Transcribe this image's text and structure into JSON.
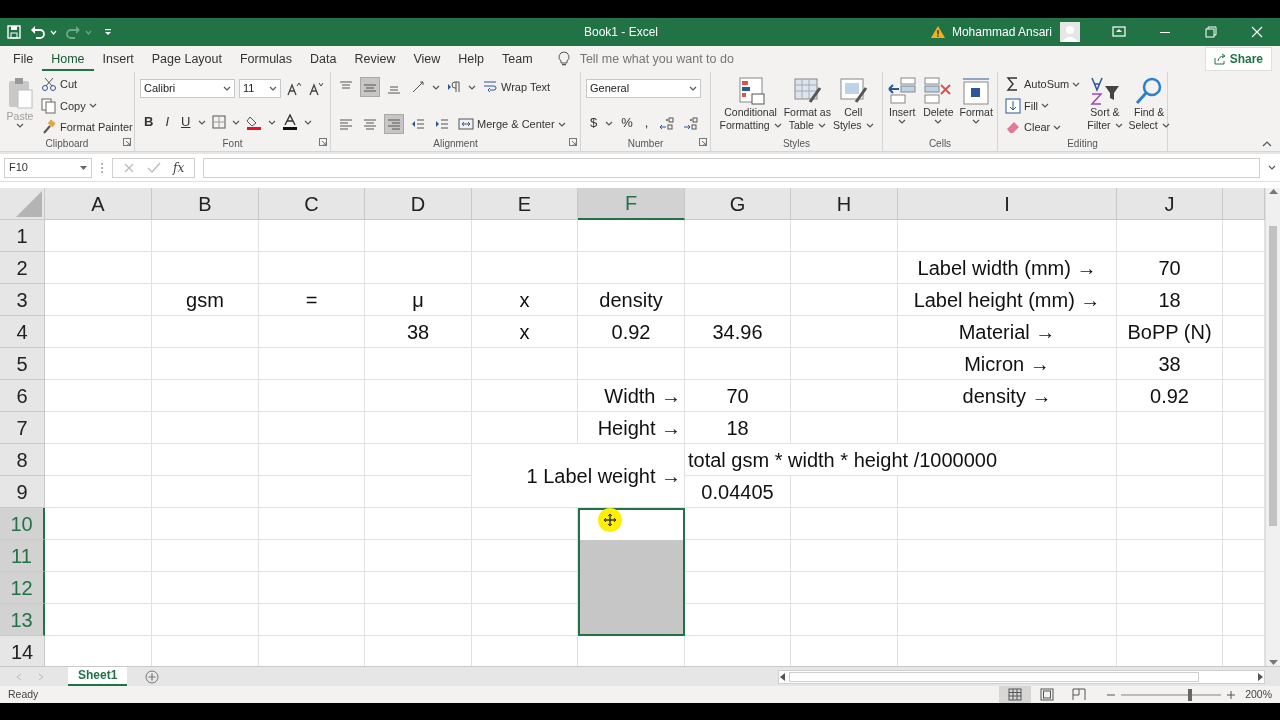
{
  "quick_access": [
    {
      "kind": "save",
      "disabled": false
    },
    {
      "kind": "undo",
      "disabled": false
    },
    {
      "kind": "redo",
      "disabled": true
    },
    {
      "kind": "customize",
      "disabled": false
    }
  ],
  "window": {
    "title": "Book1  -  Excel",
    "user": "Mohammad Ansari"
  },
  "menu_tabs": [
    {
      "label": "File",
      "selected": false
    },
    {
      "label": "Home",
      "selected": true
    },
    {
      "label": "Insert",
      "selected": false
    },
    {
      "label": "Page Layout",
      "selected": false
    },
    {
      "label": "Formulas",
      "selected": false
    },
    {
      "label": "Data",
      "selected": false
    },
    {
      "label": "Review",
      "selected": false
    },
    {
      "label": "View",
      "selected": false
    },
    {
      "label": "Help",
      "selected": false
    },
    {
      "label": "Team",
      "selected": false
    }
  ],
  "tell_me": {
    "placeholder": "Tell me what you want to do"
  },
  "share": "Share",
  "clipboard": {
    "group": "Clipboard",
    "paste": {
      "label": "Paste",
      "disabled": true
    },
    "cut": "Cut",
    "copy": "Copy",
    "format_painter": "Format Painter"
  },
  "font": {
    "group": "Font",
    "font_name": "Calibri",
    "font_size": "11",
    "format_buttons": [
      "B",
      "I",
      "U"
    ]
  },
  "alignment": {
    "group": "Alignment",
    "vertical_align": [
      {
        "selected": false
      },
      {
        "selected": true
      },
      {
        "selected": false
      }
    ],
    "horizontal_align": [
      {
        "selected": false
      },
      {
        "selected": false
      },
      {
        "selected": true
      }
    ],
    "wrap_text": "Wrap Text",
    "merge_center": "Merge & Center"
  },
  "number": {
    "group": "Number",
    "format": "General",
    "symbols": [
      "$",
      "%",
      ","
    ]
  },
  "styles": {
    "group": "Styles",
    "buttons": [
      {
        "lines": [
          "Conditional",
          "Formatting"
        ]
      },
      {
        "lines": [
          "Format as",
          "Table"
        ]
      },
      {
        "lines": [
          "Cell",
          "Styles"
        ]
      }
    ]
  },
  "cells_group": {
    "group": "Cells",
    "buttons": [
      "Insert",
      "Delete",
      "Format"
    ]
  },
  "editing": {
    "group": "Editing",
    "autosum": "AutoSum",
    "fill": "Fill",
    "clear": "Clear",
    "sort_filter": [
      "Sort &",
      "Filter"
    ],
    "find_select": [
      "Find &",
      "Select"
    ]
  },
  "name_box": "F10",
  "insert_function": "fx",
  "columns": [
    {
      "label": "A",
      "selected": false
    },
    {
      "label": "B",
      "selected": false
    },
    {
      "label": "C",
      "selected": false
    },
    {
      "label": "D",
      "selected": false
    },
    {
      "label": "E",
      "selected": false
    },
    {
      "label": "F",
      "selected": true
    },
    {
      "label": "G",
      "selected": false
    },
    {
      "label": "H",
      "selected": false
    },
    {
      "label": "I",
      "selected": false
    },
    {
      "label": "J",
      "selected": false
    }
  ],
  "rows": [
    {
      "number": "1",
      "selected": false,
      "cells": [
        null,
        null,
        null,
        null,
        null,
        null,
        null,
        null,
        null,
        null
      ]
    },
    {
      "number": "2",
      "selected": false,
      "cells": [
        null,
        null,
        null,
        null,
        null,
        null,
        null,
        null,
        {
          "text": "Label width (mm) →",
          "selected": false
        },
        {
          "text": "70",
          "selected": false
        }
      ]
    },
    {
      "number": "3",
      "selected": false,
      "cells": [
        null,
        {
          "text": "gsm",
          "selected": false
        },
        {
          "text": "=",
          "selected": false
        },
        {
          "text": "μ",
          "selected": false
        },
        {
          "text": "x",
          "selected": false
        },
        {
          "text": "density",
          "selected": false
        },
        null,
        null,
        {
          "text": "Label height (mm) →",
          "selected": false
        },
        {
          "text": "18",
          "selected": false
        }
      ]
    },
    {
      "number": "4",
      "selected": false,
      "cells": [
        null,
        null,
        null,
        {
          "text": "38",
          "selected": false
        },
        {
          "text": "x",
          "selected": false
        },
        {
          "text": "0.92",
          "selected": false
        },
        {
          "text": "34.96",
          "selected": false
        },
        null,
        {
          "text": "Material →",
          "selected": false
        },
        {
          "text": "BoPP (N)",
          "selected": false
        }
      ]
    },
    {
      "number": "5",
      "selected": false,
      "cells": [
        null,
        null,
        null,
        null,
        null,
        null,
        null,
        null,
        {
          "text": "Micron →",
          "selected": false
        },
        {
          "text": "38",
          "selected": false
        }
      ]
    },
    {
      "number": "6",
      "selected": false,
      "cells": [
        null,
        null,
        null,
        null,
        null,
        {
          "text": "Width →",
          "right_aligned": true,
          "selected": false
        },
        {
          "text": "70",
          "selected": false
        },
        null,
        {
          "text": "density →",
          "selected": false
        },
        {
          "text": "0.92",
          "selected": false
        }
      ]
    },
    {
      "number": "7",
      "selected": false,
      "cells": [
        null,
        null,
        null,
        null,
        null,
        {
          "text": "Height →",
          "right_aligned": true,
          "selected": false
        },
        {
          "text": "18",
          "selected": false
        },
        null,
        null,
        null
      ]
    },
    {
      "number": "8",
      "selected": false,
      "cells": [
        null,
        null,
        null,
        null,
        null,
        {
          "text": "1 Label weight →",
          "right_aligned": true,
          "selected": false,
          "merged_down": true
        },
        {
          "text": "total gsm * width * height /1000000",
          "left_aligned": true,
          "selected": false
        },
        null,
        null,
        null
      ]
    },
    {
      "number": "9",
      "selected": false,
      "cells": [
        null,
        null,
        null,
        null,
        null,
        null,
        {
          "text": "0.04405",
          "selected": false
        },
        null,
        null,
        null
      ]
    },
    {
      "number": "10",
      "selected": true,
      "cells": [
        null,
        null,
        null,
        null,
        null,
        {
          "selected": true,
          "active": true
        },
        null,
        null,
        null,
        null
      ]
    },
    {
      "number": "11",
      "selected": true,
      "cells": [
        null,
        null,
        null,
        null,
        null,
        {
          "selected": true,
          "active": false
        },
        null,
        null,
        null,
        null
      ]
    },
    {
      "number": "12",
      "selected": true,
      "cells": [
        null,
        null,
        null,
        null,
        null,
        {
          "selected": true,
          "active": false
        },
        null,
        null,
        null,
        null
      ]
    },
    {
      "number": "13",
      "selected": true,
      "cells": [
        null,
        null,
        null,
        null,
        null,
        {
          "selected": true,
          "active": false
        },
        null,
        null,
        null,
        null
      ]
    },
    {
      "number": "14",
      "selected": false,
      "cells": [
        null,
        null,
        null,
        null,
        null,
        null,
        null,
        null,
        null,
        null
      ]
    }
  ],
  "sheet_tabs": [
    {
      "label": "Sheet1",
      "selected": true
    }
  ],
  "status": "Ready",
  "view_buttons": [
    {
      "kind": "normal",
      "selected": true
    },
    {
      "kind": "page_layout",
      "selected": false
    },
    {
      "kind": "page_break",
      "selected": false
    }
  ],
  "zoom": {
    "level": 0.69,
    "reading": "200%"
  }
}
